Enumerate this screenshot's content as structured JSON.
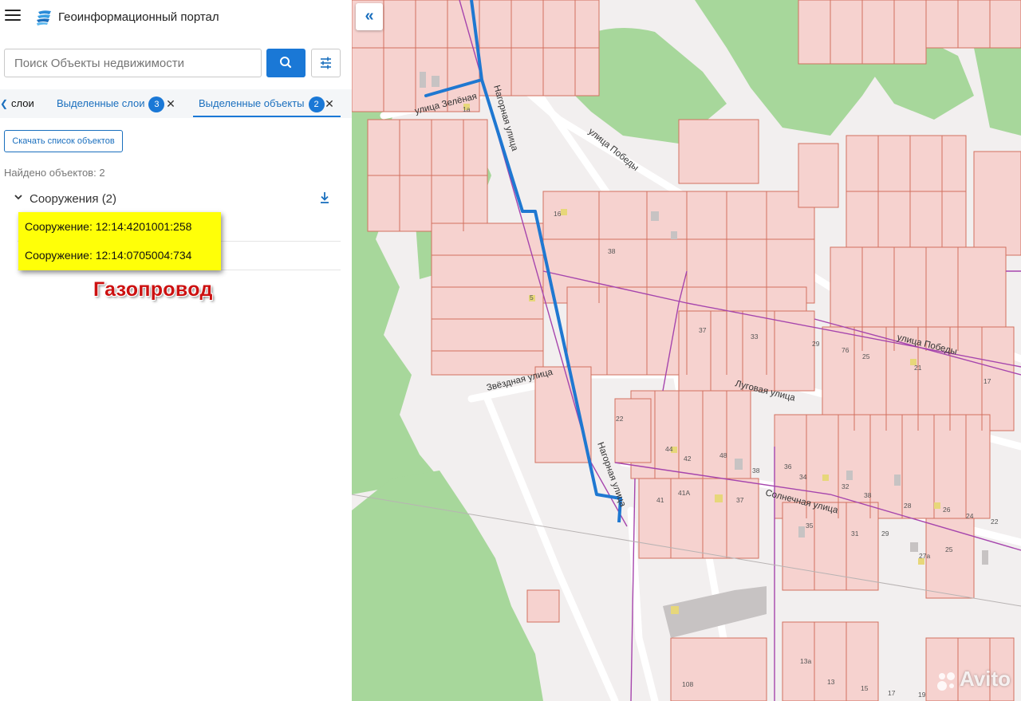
{
  "app": {
    "title": "Геоинформационный портал"
  },
  "search": {
    "placeholder": "Поиск Объекты недвижимости"
  },
  "tabs": {
    "layers": "слои",
    "selected_layers": {
      "label": "Выделенные слои",
      "count": "3"
    },
    "selected_objects": {
      "label": "Выделенные объекты",
      "count": "2"
    }
  },
  "results": {
    "download_button": "Скачать список объектов",
    "found_text": "Найдено объектов: 2",
    "group_label": "Сооружения (2)",
    "items": [
      "Сооружение: 12:14:4201001:258",
      "Сооружение: 12:14:0705004:734"
    ]
  },
  "annotation": {
    "text": "Газопровод",
    "color": "#cc1111",
    "highlight": "#ffff08"
  },
  "colors": {
    "accent": "#1a78d6",
    "gas_line": "#1f78d1",
    "parcel_fill": "#f6d2cf",
    "parcel_stroke": "#d2705f",
    "forest": "#a7d79b",
    "boundary": "#a645ad"
  },
  "icons": {
    "menu": "hamburger-icon",
    "logo": "portal-logo-icon",
    "search": "search-icon",
    "filter": "sliders-icon",
    "download": "download-icon",
    "collapse": "double-chevron-left-icon"
  },
  "map": {
    "street_labels": [
      "улица Зелёная",
      "Нагорная улица",
      "улица Победы",
      "улица Победы",
      "Звёздная улица",
      "Луговая улица",
      "Нагорная улица",
      "Солнечная улица"
    ],
    "house_numbers": [
      "1а",
      "16",
      "38",
      "5",
      "37",
      "33",
      "29",
      "76",
      "25",
      "21",
      "17",
      "22",
      "44",
      "42",
      "48",
      "38",
      "36",
      "34",
      "32",
      "38",
      "28",
      "26",
      "24",
      "22",
      "41",
      "41А",
      "37",
      "35",
      "31",
      "29",
      "27а",
      "25",
      "13а",
      "13",
      "15",
      "17",
      "19",
      "108"
    ]
  },
  "watermark": "Avito"
}
